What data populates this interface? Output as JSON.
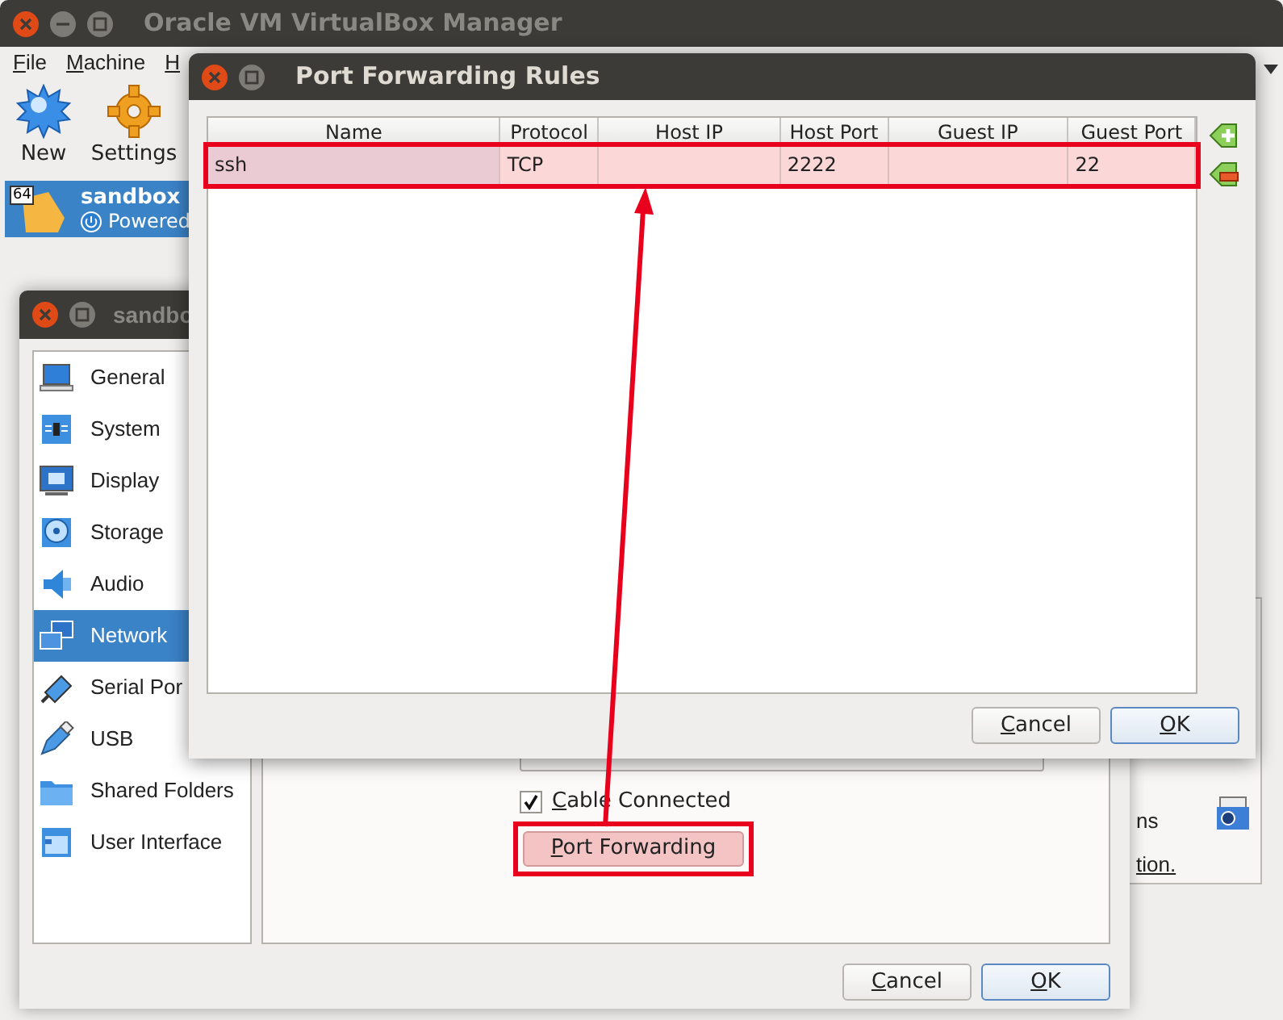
{
  "window": {
    "title": "Oracle VM VirtualBox Manager"
  },
  "menu": [
    "File",
    "Machine",
    "H"
  ],
  "toolbar": [
    {
      "label": "New"
    },
    {
      "label": "Settings"
    }
  ],
  "vm_list": [
    {
      "badge": "64",
      "name": "sandbox",
      "state": "Powered",
      "selected": true
    }
  ],
  "details_panel": {
    "texts": [
      "ns",
      "tion."
    ]
  },
  "settings_dialog": {
    "title": "sandbo",
    "sidebar": [
      {
        "label": "General",
        "selected": false
      },
      {
        "label": "System",
        "selected": false
      },
      {
        "label": "Display",
        "selected": false
      },
      {
        "label": "Storage",
        "selected": false
      },
      {
        "label": "Audio",
        "selected": false
      },
      {
        "label": "Network",
        "selected": true
      },
      {
        "label": "Serial Por",
        "selected": false
      },
      {
        "label": "USB",
        "selected": false
      },
      {
        "label": "Shared Folders",
        "selected": false
      },
      {
        "label": "User Interface",
        "selected": false
      }
    ],
    "cable_connected": {
      "label": "Cable Connected",
      "checked": true
    },
    "port_forwarding_button": {
      "label": "Port Forwarding",
      "highlighted": true
    },
    "buttons": [
      {
        "label": "Cancel",
        "default": false
      },
      {
        "label": "OK",
        "default": true
      }
    ]
  },
  "port_forwarding_dialog": {
    "title": "Port Forwarding Rules",
    "columns": [
      "Name",
      "Protocol",
      "Host IP",
      "Host Port",
      "Guest IP",
      "Guest Port"
    ],
    "rows": [
      {
        "cells": [
          "ssh",
          "TCP",
          "",
          "2222",
          "",
          "22"
        ],
        "selected": true,
        "highlighted": true
      }
    ],
    "buttons": [
      {
        "label": "Cancel",
        "default": false
      },
      {
        "label": "OK",
        "default": true
      }
    ]
  }
}
